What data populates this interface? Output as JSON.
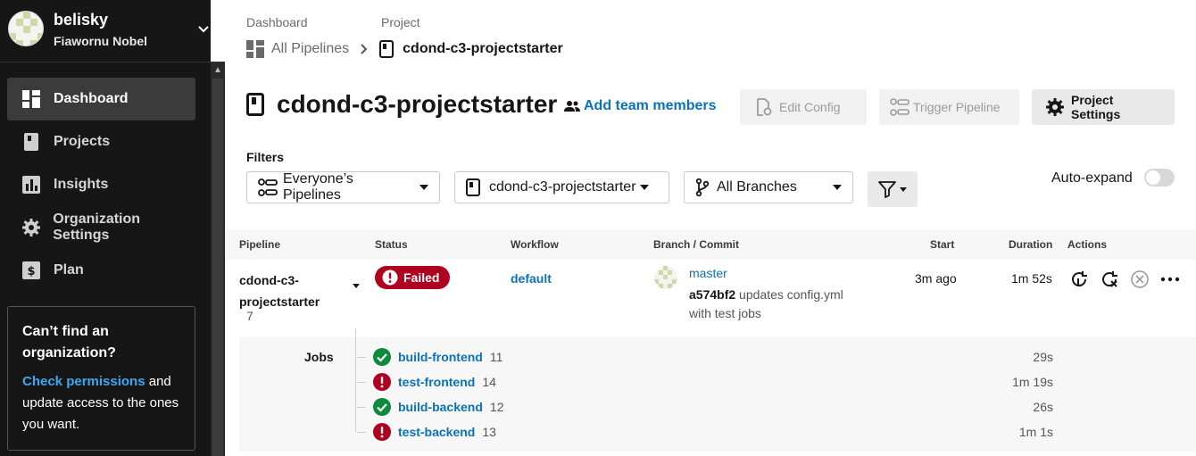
{
  "user": {
    "name": "belisky",
    "org": "Fiawornu Nobel"
  },
  "nav": [
    {
      "label": "Dashboard",
      "icon": "dashboard-icon",
      "active": true
    },
    {
      "label": "Projects",
      "icon": "projects-icon"
    },
    {
      "label": "Insights",
      "icon": "insights-icon"
    },
    {
      "label": "Organization Settings",
      "icon": "gear-icon"
    },
    {
      "label": "Plan",
      "icon": "plan-icon"
    }
  ],
  "help": {
    "title": "Can’t find an organization?",
    "link": "Check permissions",
    "text": " and update access to the ones you want."
  },
  "breadcrumb": {
    "label1": "Dashboard",
    "label2": "Project",
    "item1": "All Pipelines",
    "item2": "cdond-c3-projectstarter"
  },
  "header": {
    "title": "cdond-c3-projectstarter",
    "add_team": "Add team members",
    "edit_config": "Edit Config",
    "trigger": "Trigger Pipeline",
    "settings": "Project Settings"
  },
  "filters": {
    "label": "Filters",
    "pipelines": "Everyone’s Pipelines",
    "project": "cdond-c3-projectstarter",
    "branches": "All Branches",
    "auto_expand": "Auto-expand"
  },
  "table": {
    "headers": [
      "Pipeline",
      "Status",
      "Workflow",
      "Branch / Commit",
      "Start",
      "Duration",
      "Actions"
    ],
    "row": {
      "pipeline": "cdond-c3-projectstarter",
      "number": "7",
      "status": "Failed",
      "workflow": "default",
      "branch": "master",
      "sha": "a574bf2",
      "message": " updates config.yml with test jobs",
      "start": "3m ago",
      "duration": "1m 52s"
    },
    "jobs_label": "Jobs",
    "jobs": [
      {
        "name": "build-frontend",
        "num": "11",
        "status": "success",
        "duration": "29s"
      },
      {
        "name": "test-frontend",
        "num": "14",
        "status": "failed",
        "duration": "1m 19s"
      },
      {
        "name": "build-backend",
        "num": "12",
        "status": "success",
        "duration": "26s"
      },
      {
        "name": "test-backend",
        "num": "13",
        "status": "failed",
        "duration": "1m 1s"
      }
    ]
  },
  "colors": {
    "link": "#0b72b9",
    "failed": "#b00020",
    "success": "#0d8a3b",
    "sidebar": "#161616"
  }
}
